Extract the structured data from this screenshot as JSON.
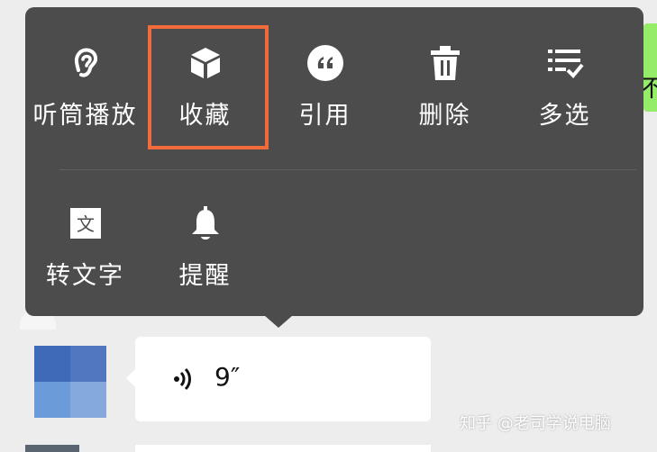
{
  "menu": {
    "row1": [
      {
        "label": "听筒播放",
        "icon": "ear-icon"
      },
      {
        "label": "收藏",
        "icon": "cube-icon"
      },
      {
        "label": "引用",
        "icon": "quote-icon"
      },
      {
        "label": "删除",
        "icon": "trash-icon"
      },
      {
        "label": "多选",
        "icon": "multi-select-icon"
      }
    ],
    "row2": [
      {
        "label": "转文字",
        "icon": "text-convert-icon"
      },
      {
        "label": "提醒",
        "icon": "bell-icon"
      }
    ],
    "highlighted_item": "收藏"
  },
  "chat": {
    "voice_duration": "9″",
    "right_bubble_glyph": "不"
  },
  "watermark": "知乎 @老司学说电脑",
  "colors": {
    "menu_bg": "#4c4c4c",
    "highlight": "#f26b3a",
    "green_bubble": "#95ec69"
  }
}
